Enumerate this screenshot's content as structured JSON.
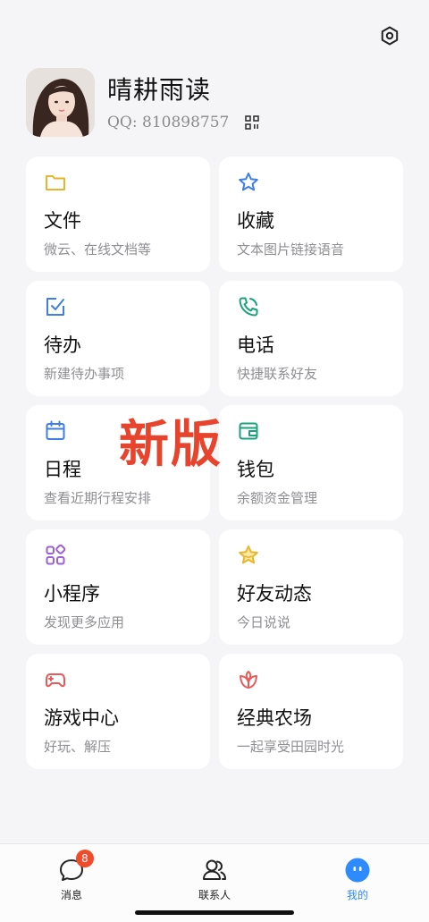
{
  "profile": {
    "nickname": "晴耕雨读",
    "qq": "QQ: 810898757"
  },
  "cards": [
    {
      "title": "文件",
      "subtitle": "微云、在线文档等",
      "icon": "folder-icon",
      "color": "#e8b62c"
    },
    {
      "title": "收藏",
      "subtitle": "文本图片链接语音",
      "icon": "star-icon",
      "color": "#3f7ee8"
    },
    {
      "title": "待办",
      "subtitle": "新建待办事项",
      "icon": "todo-icon",
      "color": "#3f7ee8"
    },
    {
      "title": "电话",
      "subtitle": "快捷联系好友",
      "icon": "phone-icon",
      "color": "#1aa37a"
    },
    {
      "title": "日程",
      "subtitle": "查看近期行程安排",
      "icon": "calendar-icon",
      "color": "#3f7ee8"
    },
    {
      "title": "钱包",
      "subtitle": "余额资金管理",
      "icon": "wallet-icon",
      "color": "#1aa37a"
    },
    {
      "title": "小程序",
      "subtitle": "发现更多应用",
      "icon": "miniapp-icon",
      "color": "#9b5fd6"
    },
    {
      "title": "好友动态",
      "subtitle": "今日说说",
      "icon": "friends-star-icon",
      "color": "#e8b62c"
    },
    {
      "title": "游戏中心",
      "subtitle": "好玩、解压",
      "icon": "gamepad-icon",
      "color": "#e85a5a"
    },
    {
      "title": "经典农场",
      "subtitle": "一起享受田园时光",
      "icon": "farm-icon",
      "color": "#e85a5a"
    }
  ],
  "watermark": "新版",
  "tabs": [
    {
      "label": "消息",
      "icon": "message-icon",
      "badge": "8",
      "active": false
    },
    {
      "label": "联系人",
      "icon": "contacts-icon",
      "active": false
    },
    {
      "label": "我的",
      "icon": "me-icon",
      "active": true
    }
  ],
  "colors": {
    "accent": "#2e8bff",
    "badge": "#f04b2a",
    "watermark": "#e8442d"
  }
}
